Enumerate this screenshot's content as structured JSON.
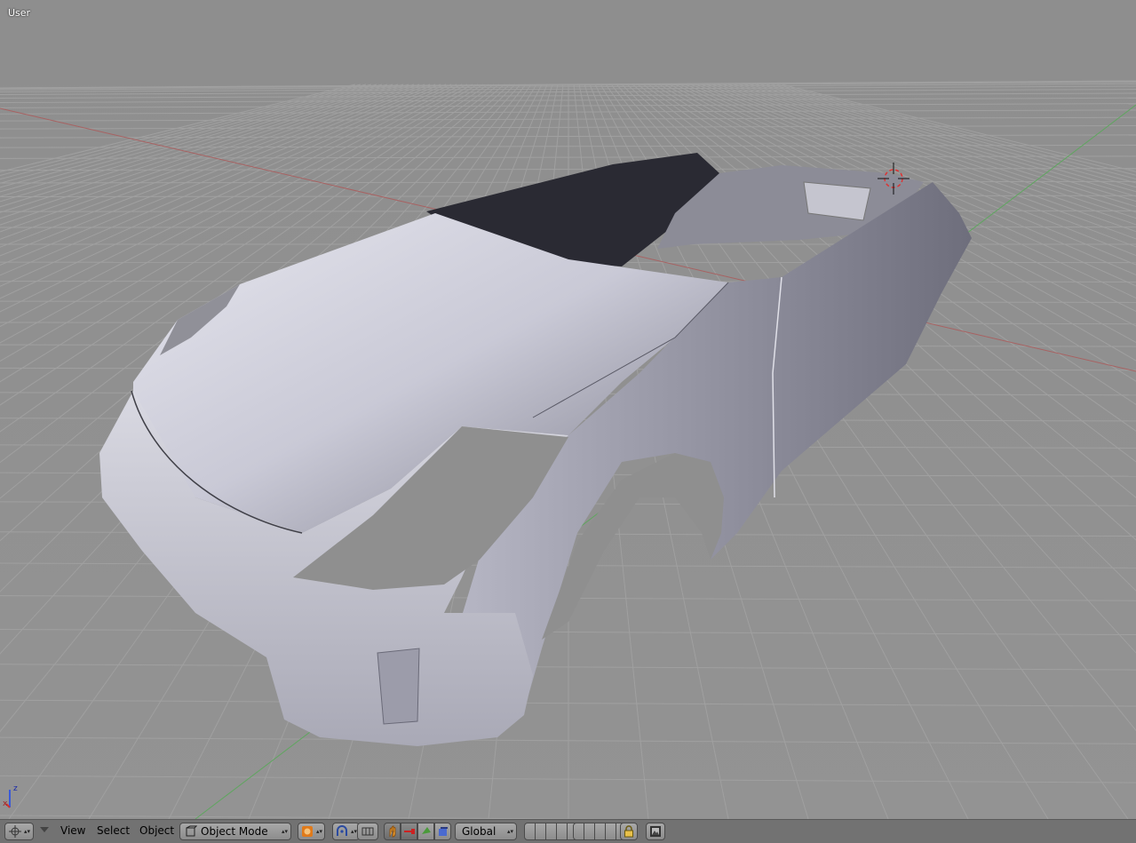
{
  "viewport": {
    "view_label": "User",
    "background_color": "#8f8f8f",
    "grid_color": "#a6a6a6",
    "x_axis_color": "#a85858",
    "y_axis_color": "#6aa86a",
    "model_color": "#d8d8e4"
  },
  "header": {
    "editor_type_icon": "viewport-3d-icon",
    "menus": {
      "view": "View",
      "select": "Select",
      "object": "Object"
    },
    "mode_selector": {
      "icon": "object-mode-icon",
      "value": "Object Mode"
    },
    "shading_icon": "solid-shading-icon",
    "pivot_icon": "pivot-point-icon",
    "manipulator_icons": [
      "manipulator-toggle-icon",
      "translate-icon",
      "rotate-icon",
      "scale-icon"
    ],
    "orientation": {
      "icon": "orientation-icon",
      "value": "Global"
    },
    "layer_lock_icon": "lock-icon",
    "render_icon": "render-preview-icon"
  },
  "axis_gizmo": {
    "x_label": "x",
    "z_label": "z"
  }
}
